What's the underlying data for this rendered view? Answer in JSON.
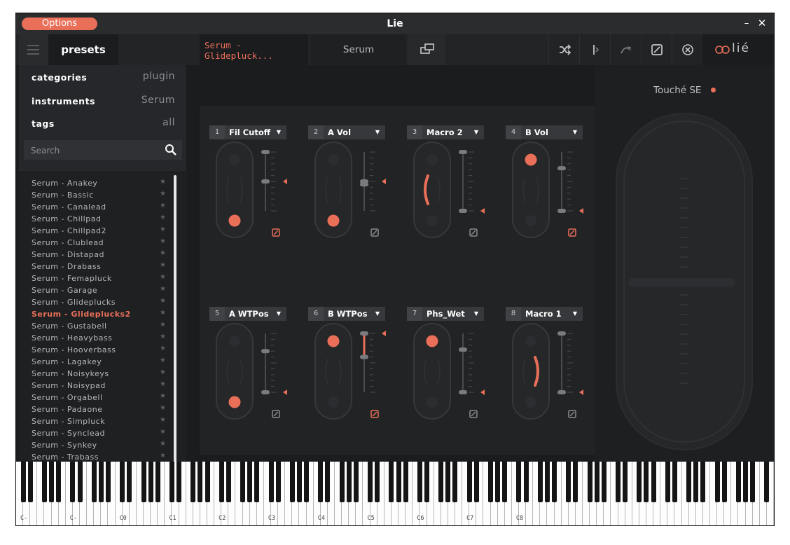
{
  "window": {
    "title": "Lie",
    "options_label": "Options",
    "minimize_glyph": "–",
    "close_glyph": "✕"
  },
  "toolbar": {
    "presets_tab": "presets",
    "preset_name": "Serum -\nGlidepluck...",
    "plugin_name": "Serum",
    "brand": "lié",
    "icons": [
      "window-icon",
      "shuffle-icon",
      "split-icon",
      "curve-icon",
      "bypass-icon",
      "clear-icon"
    ]
  },
  "sidebar": {
    "filters": [
      {
        "key": "categories",
        "value": "plugin"
      },
      {
        "key": "instruments",
        "value": "Serum"
      },
      {
        "key": "tags",
        "value": "all"
      }
    ],
    "search_placeholder": "Search",
    "star_glyph": "★",
    "presets": [
      "Serum - Anakey",
      "Serum - Bassic",
      "Serum - Canalead",
      "Serum - Chillpad",
      "Serum - Chillpad2",
      "Serum - Clublead",
      "Serum - Distapad",
      "Serum - Drabass",
      "Serum - Femapluck",
      "Serum - Garage",
      "Serum - Glideplucks",
      "Serum - Glideplucks2",
      "Serum - Gustabell",
      "Serum - Heavybass",
      "Serum - Hooverbass",
      "Serum - Lagakey",
      "Serum - Noisykeys",
      "Serum - Noisypad",
      "Serum - Orgabell",
      "Serum - Padaone",
      "Serum - Simpluck",
      "Serum - Synclead",
      "Serum - Synkey",
      "Serum - Trabass"
    ],
    "active_preset": "Serum - Glideplucks2"
  },
  "macros": [
    {
      "num": "1",
      "name": "Fil Cutoff",
      "dot": "bottom",
      "arc": "none",
      "active": true
    },
    {
      "num": "2",
      "name": "A Vol",
      "dot": "bottom",
      "arc": "none",
      "active": false
    },
    {
      "num": "3",
      "name": "Macro 2",
      "dot": "none",
      "arc": "left",
      "active": false
    },
    {
      "num": "4",
      "name": "B Vol",
      "dot": "top",
      "arc": "none",
      "active": true
    },
    {
      "num": "5",
      "name": "A WTPos",
      "dot": "bottom",
      "arc": "none",
      "active": false
    },
    {
      "num": "6",
      "name": "B WTPos",
      "dot": "top",
      "arc": "none",
      "active": true
    },
    {
      "num": "7",
      "name": "Phs_Wet",
      "dot": "top",
      "arc": "none",
      "active": false
    },
    {
      "num": "8",
      "name": "Macro 1",
      "dot": "none",
      "arc": "right",
      "active": false
    }
  ],
  "touche": {
    "label": "Touché SE"
  },
  "keyboard": {
    "labels": [
      "C-",
      "C-",
      "C0",
      "C1",
      "C2",
      "C3",
      "C4",
      "C5",
      "C6",
      "C7",
      "C8"
    ]
  },
  "colors": {
    "accent": "#e96f59",
    "background": "#1b1c1e",
    "panel": "#222325"
  }
}
